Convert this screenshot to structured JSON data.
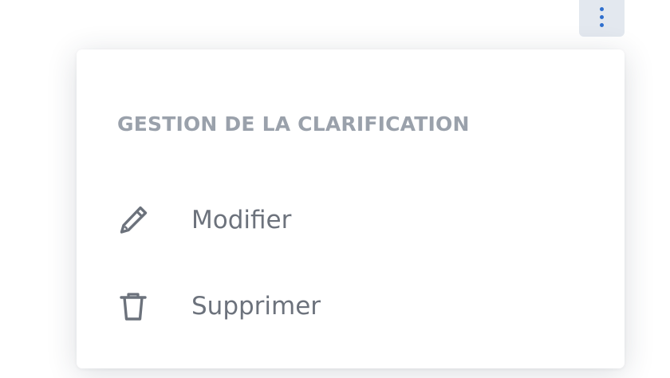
{
  "toolbar": {
    "more_icon": "kebab-vertical-icon",
    "accent_color": "#2f6fce"
  },
  "menu": {
    "heading": "GESTION DE LA CLARIFICATION",
    "items": [
      {
        "label": "Modifier",
        "icon": "pencil-icon"
      },
      {
        "label": "Supprimer",
        "icon": "trash-icon"
      }
    ]
  }
}
